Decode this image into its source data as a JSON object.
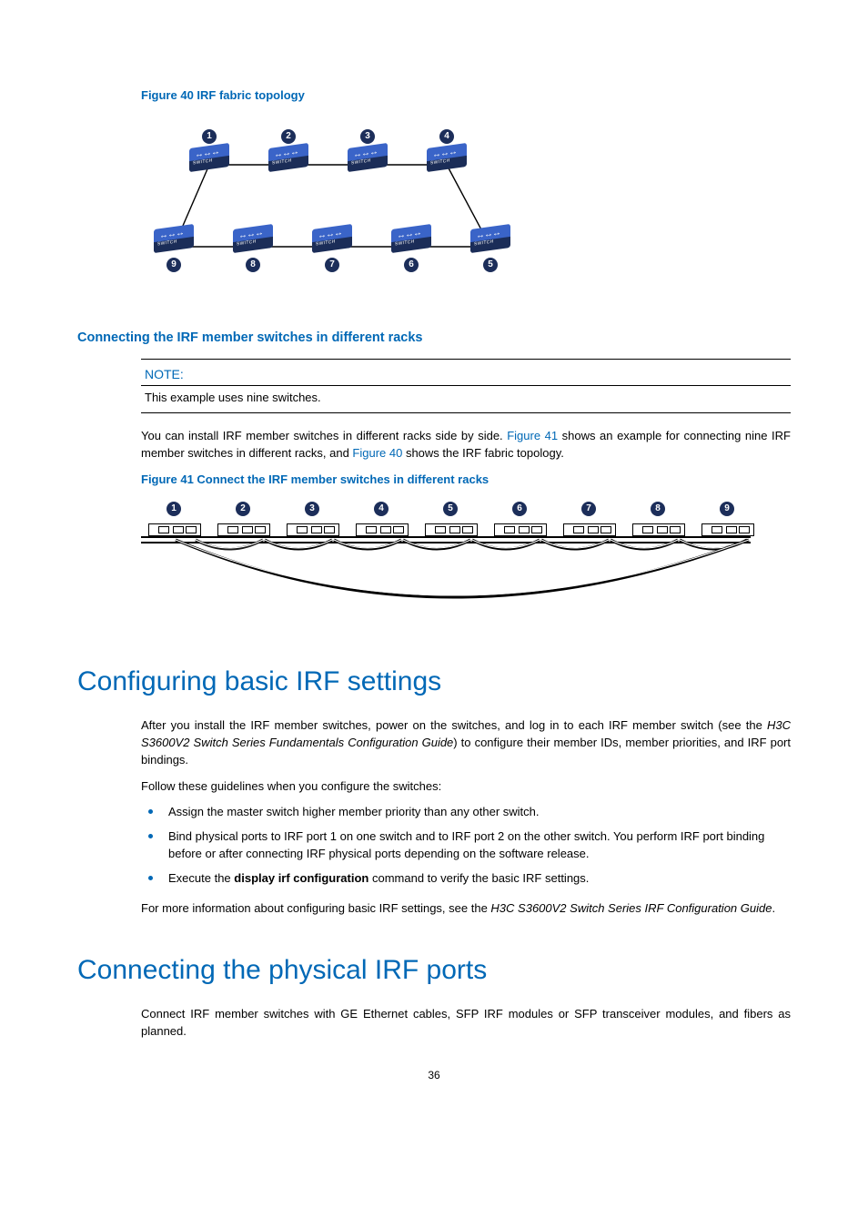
{
  "figure40": {
    "caption": "Figure 40 IRF fabric topology",
    "top_nodes": [
      1,
      2,
      3,
      4
    ],
    "bottom_nodes": [
      9,
      8,
      7,
      6,
      5
    ],
    "switch_text": "SWITCH"
  },
  "section1": {
    "heading": "Connecting the IRF member switches in different racks",
    "note_label": "NOTE:",
    "note_body": "This example uses nine switches.",
    "para_before": "You can install IRF member switches in different racks side by side. ",
    "link1": "Figure 41",
    "para_mid": " shows an example for connecting nine IRF member switches in different racks, and ",
    "link2": "Figure 40",
    "para_after": " shows the IRF fabric topology."
  },
  "figure41": {
    "caption": "Figure 41 Connect the IRF member switches in different racks",
    "nodes": [
      1,
      2,
      3,
      4,
      5,
      6,
      7,
      8,
      9
    ]
  },
  "section2": {
    "heading": "Configuring basic IRF settings",
    "para1_a": "After you install the IRF member switches, power on the switches, and log in to each IRF member switch (see the ",
    "para1_i": "H3C S3600V2 Switch Series Fundamentals Configuration Guide",
    "para1_b": ") to configure their member IDs, member priorities, and IRF port bindings.",
    "para2": "Follow these guidelines when you configure the switches:",
    "bullets": [
      "Assign the master switch higher member priority than any other switch.",
      "Bind physical ports to IRF port 1 on one switch and to IRF port 2 on the other switch. You perform IRF port binding before or after connecting IRF physical ports depending on the software release.",
      ""
    ],
    "bullet3_a": "Execute the ",
    "bullet3_bold": "display irf configuration",
    "bullet3_b": " command to verify the basic IRF settings.",
    "para3_a": "For more information about configuring basic IRF settings, see the ",
    "para3_i": "H3C S3600V2 Switch Series IRF Configuration Guide",
    "para3_b": "."
  },
  "section3": {
    "heading": "Connecting the physical IRF ports",
    "para1": "Connect IRF member switches with GE Ethernet cables, SFP IRF modules or SFP transceiver modules, and fibers as planned."
  },
  "page_number": "36",
  "chart_data": [
    {
      "type": "diagram",
      "title": "Figure 40 IRF fabric topology",
      "nodes": [
        1,
        2,
        3,
        4,
        5,
        6,
        7,
        8,
        9
      ],
      "edges": [
        [
          1,
          2
        ],
        [
          2,
          3
        ],
        [
          3,
          4
        ],
        [
          4,
          5
        ],
        [
          5,
          6
        ],
        [
          6,
          7
        ],
        [
          7,
          8
        ],
        [
          8,
          9
        ],
        [
          9,
          1
        ]
      ],
      "layout": "ring-two-rows"
    },
    {
      "type": "diagram",
      "title": "Figure 41 Connect the IRF member switches in different racks",
      "nodes": [
        1,
        2,
        3,
        4,
        5,
        6,
        7,
        8,
        9
      ],
      "edges": [
        [
          1,
          2
        ],
        [
          2,
          3
        ],
        [
          3,
          4
        ],
        [
          4,
          5
        ],
        [
          5,
          6
        ],
        [
          6,
          7
        ],
        [
          7,
          8
        ],
        [
          8,
          9
        ],
        [
          1,
          9
        ]
      ],
      "layout": "rack-row"
    }
  ]
}
